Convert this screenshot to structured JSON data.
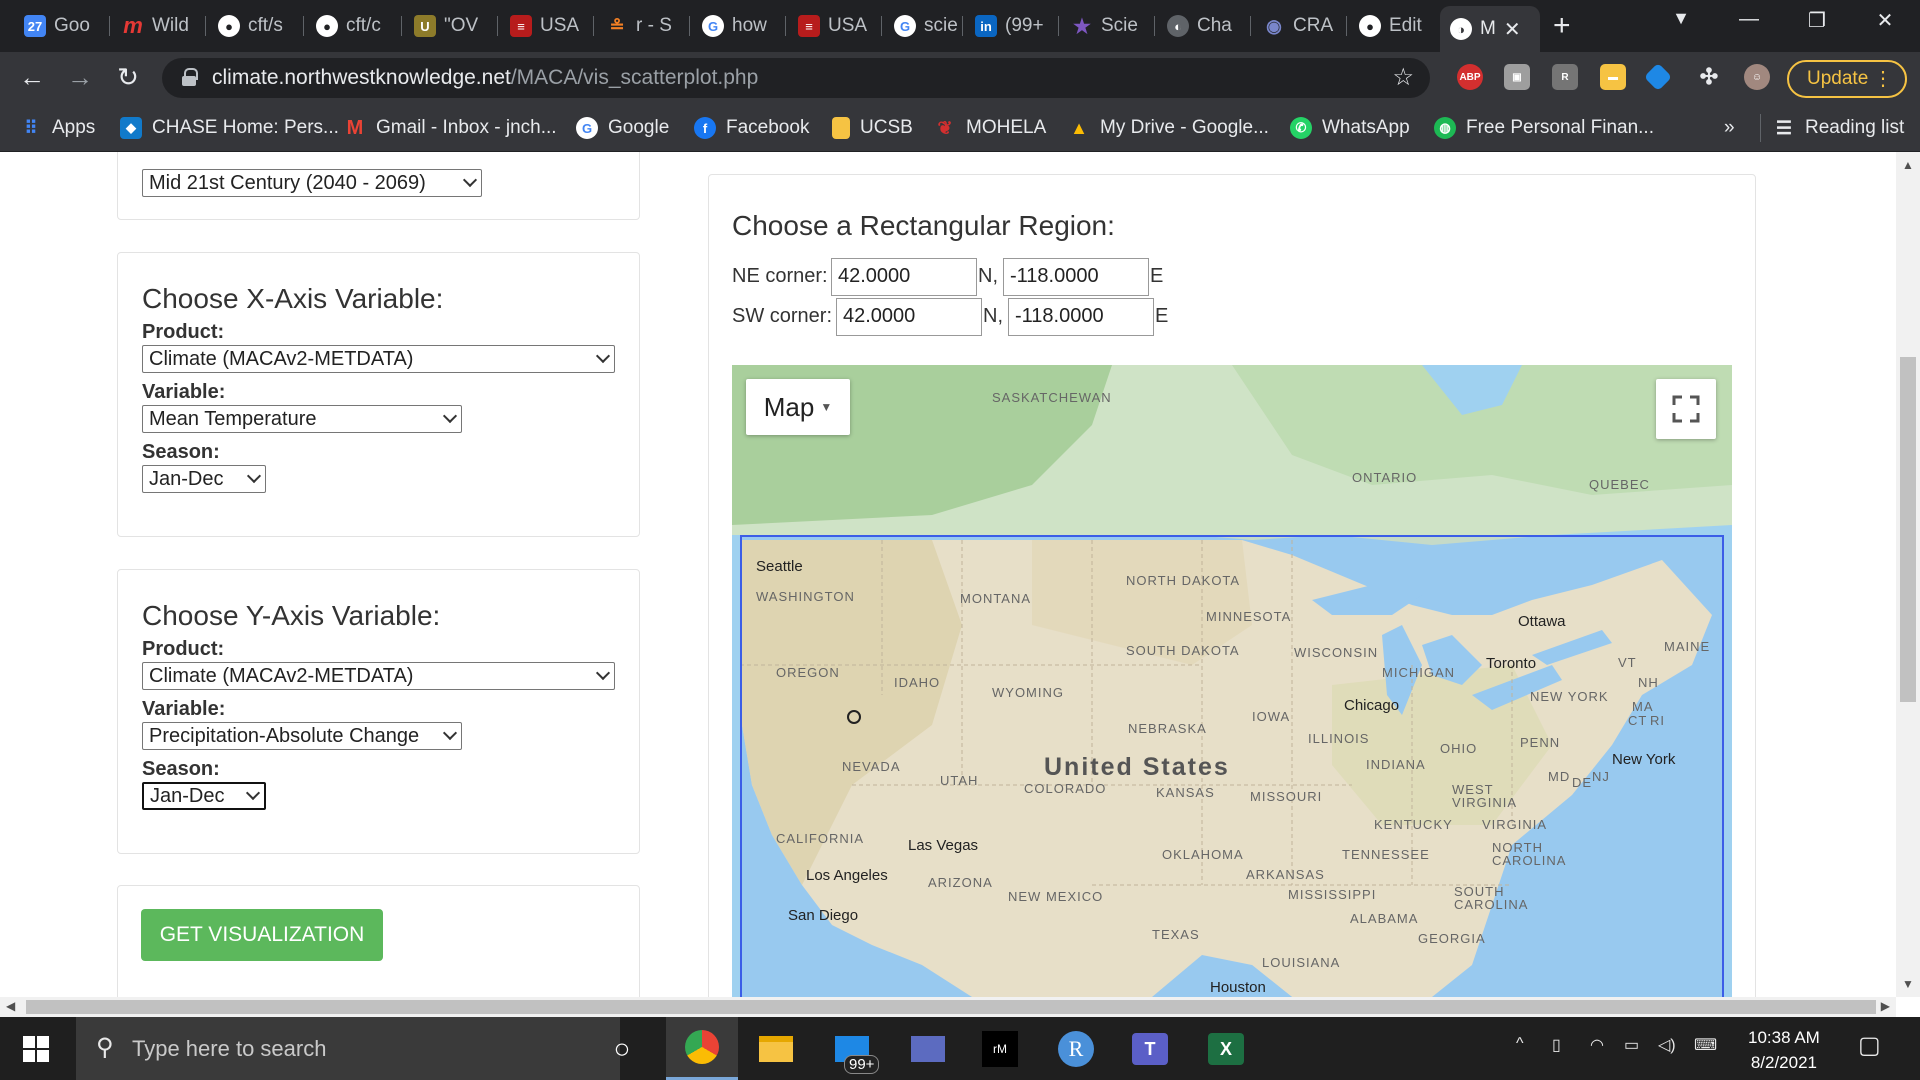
{
  "browser": {
    "tabs": [
      {
        "title": "Goo",
        "icon": "calendar-icon",
        "color": "#4285f4"
      },
      {
        "title": "Wild",
        "icon": "m-icon",
        "color": "#c62828"
      },
      {
        "title": "cft/s",
        "icon": "github-icon",
        "color": "#ffffff"
      },
      {
        "title": "cft/c",
        "icon": "github-icon",
        "color": "#ffffff"
      },
      {
        "title": "\"OV",
        "icon": "u-icon",
        "color": "#8d7b2a"
      },
      {
        "title": "USA",
        "icon": "flag-icon",
        "color": "#b71c1c"
      },
      {
        "title": "r - S",
        "icon": "stackoverflow-icon",
        "color": "#f48024"
      },
      {
        "title": "how",
        "icon": "google-icon",
        "color": "#ffffff"
      },
      {
        "title": "USA",
        "icon": "flag-icon",
        "color": "#b71c1c"
      },
      {
        "title": "scie",
        "icon": "google-icon",
        "color": "#ffffff"
      },
      {
        "title": "(99+",
        "icon": "linkedin-icon",
        "color": "#0a66c2"
      },
      {
        "title": "Scie",
        "icon": "star-icon",
        "color": "#7e57c2"
      },
      {
        "title": "Cha",
        "icon": "globe-icon",
        "color": "#9e9e9e"
      },
      {
        "title": "CRA",
        "icon": "eye-icon",
        "color": "#5c6bc0"
      },
      {
        "title": "Edit",
        "icon": "github-icon",
        "color": "#ffffff"
      },
      {
        "title": "M",
        "icon": "globe-icon",
        "color": "#ffffff"
      }
    ],
    "url_domain": "climate.northwestknowledge.net",
    "url_path": "/MACA/vis_scatterplot.php",
    "update_label": "Update",
    "bookmarks": [
      {
        "label": "Apps",
        "icon": "apps-grid-icon",
        "color": "#4285f4"
      },
      {
        "label": "CHASE Home: Pers...",
        "icon": "chase-icon",
        "color": "#117aca"
      },
      {
        "label": "Gmail - Inbox - jnch...",
        "icon": "gmail-icon",
        "color": "#ea4335"
      },
      {
        "label": "Google",
        "icon": "google-icon",
        "color": "#ffffff"
      },
      {
        "label": "Facebook",
        "icon": "facebook-icon",
        "color": "#1877f2"
      },
      {
        "label": "UCSB",
        "icon": "folder-icon",
        "color": "#f6c343"
      },
      {
        "label": "MOHELA",
        "icon": "mohela-icon",
        "color": "#d32f2f"
      },
      {
        "label": "My Drive - Google...",
        "icon": "drive-icon",
        "color": "#fbbc04"
      },
      {
        "label": "WhatsApp",
        "icon": "whatsapp-icon",
        "color": "#25d366"
      },
      {
        "label": "Free Personal Finan...",
        "icon": "mint-icon",
        "color": "#1db954"
      }
    ],
    "more_bookmarks": "»",
    "reading_list": "Reading list"
  },
  "page": {
    "time_period_value": "Mid 21st Century (2040 - 2069)",
    "x_axis": {
      "title": "Choose X-Axis Variable:",
      "product_label": "Product:",
      "product_value": "Climate (MACAv2-METDATA)",
      "variable_label": "Variable:",
      "variable_value": "Mean Temperature",
      "season_label": "Season:",
      "season_value": "Jan-Dec"
    },
    "y_axis": {
      "title": "Choose Y-Axis Variable:",
      "product_label": "Product:",
      "product_value": "Climate (MACAv2-METDATA)",
      "variable_label": "Variable:",
      "variable_value": "Precipitation-Absolute Change",
      "season_label": "Season:",
      "season_value": "Jan-Dec"
    },
    "visualize_button": "GET VISUALIZATION",
    "region": {
      "title": "Choose a Rectangular Region:",
      "ne_label": "NE corner:",
      "ne_lat": "42.0000",
      "ne_lon": "-118.0000",
      "sw_label": "SW corner:",
      "sw_lat": "42.0000",
      "sw_lon": "-118.0000",
      "n_suffix": "N,",
      "e_suffix": "E"
    },
    "map": {
      "type_button": "Map",
      "country_label": "United States",
      "regions": [
        "SASKATCHEWAN",
        "ONTARIO",
        "QUEBEC",
        "WASHINGTON",
        "MONTANA",
        "NORTH DAKOTA",
        "MINNESOTA",
        "SOUTH DAKOTA",
        "WISCONSIN",
        "MICHIGAN",
        "OREGON",
        "IDAHO",
        "WYOMING",
        "IOWA",
        "NEBRASKA",
        "ILLINOIS",
        "NEVADA",
        "UTAH",
        "COLORADO",
        "KANSAS",
        "MISSOURI",
        "INDIANA",
        "OHIO",
        "PENN",
        "CALIFORNIA",
        "OKLAHOMA",
        "TENNESSEE",
        "KENTUCKY",
        "ARIZONA",
        "NEW MEXICO",
        "ARKANSAS",
        "TEXAS",
        "MISSISSIPPI",
        "ALABAMA",
        "GEORGIA",
        "LOUISIANA",
        "WEST VIRGINIA",
        "VIRGINIA",
        "NORTH CAROLINA",
        "SOUTH CAROLINA",
        "NEW YORK",
        "MAINE",
        "VT",
        "NH",
        "MA",
        "CT",
        "RI",
        "MD",
        "DE",
        "NJ"
      ],
      "cities": [
        "Seattle",
        "Ottawa",
        "Toronto",
        "Chicago",
        "New York",
        "Las Vegas",
        "Los Angeles",
        "San Diego",
        "Houston"
      ]
    }
  },
  "taskbar": {
    "search_placeholder": "Type here to search",
    "mail_badge": "99+",
    "time": "10:38 AM",
    "date": "8/2/2021"
  }
}
